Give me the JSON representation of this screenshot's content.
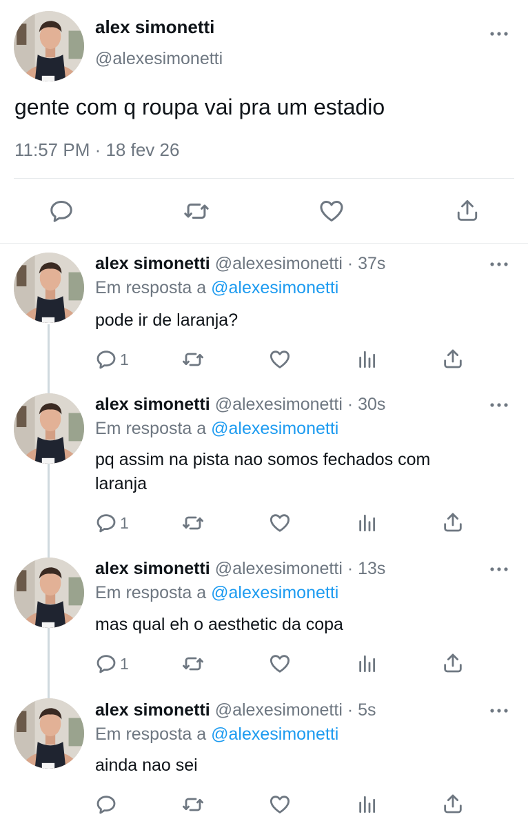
{
  "main_tweet": {
    "display_name": "alex simonetti",
    "handle": "@alexesimonetti",
    "text": "gente com q roupa vai pra um estadio",
    "meta": "11:57 PM · 18 fev 26"
  },
  "replies": [
    {
      "display_name": "alex simonetti",
      "handle": "@alexesimonetti",
      "time": "· 37s",
      "reply_prefix": "Em resposta a",
      "reply_to": "@alexesimonetti",
      "text_lines": [
        "pode ir de laranja?"
      ],
      "reply_count": "1"
    },
    {
      "display_name": "alex simonetti",
      "handle": "@alexesimonetti",
      "time": "· 30s",
      "reply_prefix": "Em resposta a",
      "reply_to": "@alexesimonetti",
      "text_lines": [
        "pq assim na pista nao somos fechados com",
        "laranja"
      ],
      "reply_count": "1"
    },
    {
      "display_name": "alex simonetti",
      "handle": "@alexesimonetti",
      "time": "· 13s",
      "reply_prefix": "Em resposta a",
      "reply_to": "@alexesimonetti",
      "text_lines": [
        "mas qual eh o aesthetic da copa"
      ],
      "reply_count": "1"
    },
    {
      "display_name": "alex simonetti",
      "handle": "@alexesimonetti",
      "time": "· 5s",
      "reply_prefix": "Em resposta a",
      "reply_to": "@alexesimonetti",
      "text_lines": [
        "ainda nao sei"
      ],
      "reply_count": ""
    }
  ],
  "icons": {
    "reply": "speech-bubble-icon",
    "retweet": "retweet-arrows-icon",
    "like": "heart-icon",
    "analytics": "bar-chart-icon",
    "share": "share-upload-icon",
    "more": "more-dots-icon"
  },
  "colors": {
    "text": "#0f1419",
    "secondary": "#6e7781",
    "link": "#1d9bf0",
    "divider": "#e6e9eb",
    "thread_line": "#cfd9de"
  }
}
